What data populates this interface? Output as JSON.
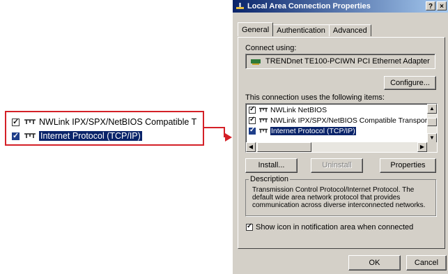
{
  "callout": {
    "items": [
      {
        "label": "NWLink IPX/SPX/NetBIOS Compatible T",
        "checked": true,
        "selected": false
      },
      {
        "label": "Internet Protocol (TCP/IP)",
        "checked": true,
        "selected": true
      }
    ]
  },
  "dialog": {
    "title": "Local Area Connection Properties",
    "help_btn": "?",
    "close_btn": "×",
    "tabs": [
      {
        "label": "General",
        "active": true
      },
      {
        "label": "Authentication",
        "active": false
      },
      {
        "label": "Advanced",
        "active": false
      }
    ],
    "connect_using_label": "Connect using:",
    "adapter_name": "TRENDnet TE100-PCIWN PCI Ethernet Adapter",
    "configure_btn": "Configure...",
    "items_label": "This connection uses the following items:",
    "items": [
      {
        "label": "NWLink NetBIOS",
        "checked": true,
        "selected": false
      },
      {
        "label": "NWLink IPX/SPX/NetBIOS Compatible Transport Prot",
        "checked": true,
        "selected": false
      },
      {
        "label": "Internet Protocol (TCP/IP)",
        "checked": true,
        "selected": true
      }
    ],
    "install_btn": "Install...",
    "uninstall_btn": "Uninstall",
    "properties_btn": "Properties",
    "description_legend": "Description",
    "description_text": "Transmission Control Protocol/Internet Protocol. The default wide area network protocol that provides communication across diverse interconnected networks.",
    "show_icon_label": "Show icon in notification area when connected",
    "show_icon_checked": true,
    "ok_btn": "OK",
    "cancel_btn": "Cancel"
  },
  "colors": {
    "callout_border": "#d42027",
    "selection": "#0a246a",
    "titlebar_start": "#0a246a",
    "window_face": "#d4d0c8"
  }
}
